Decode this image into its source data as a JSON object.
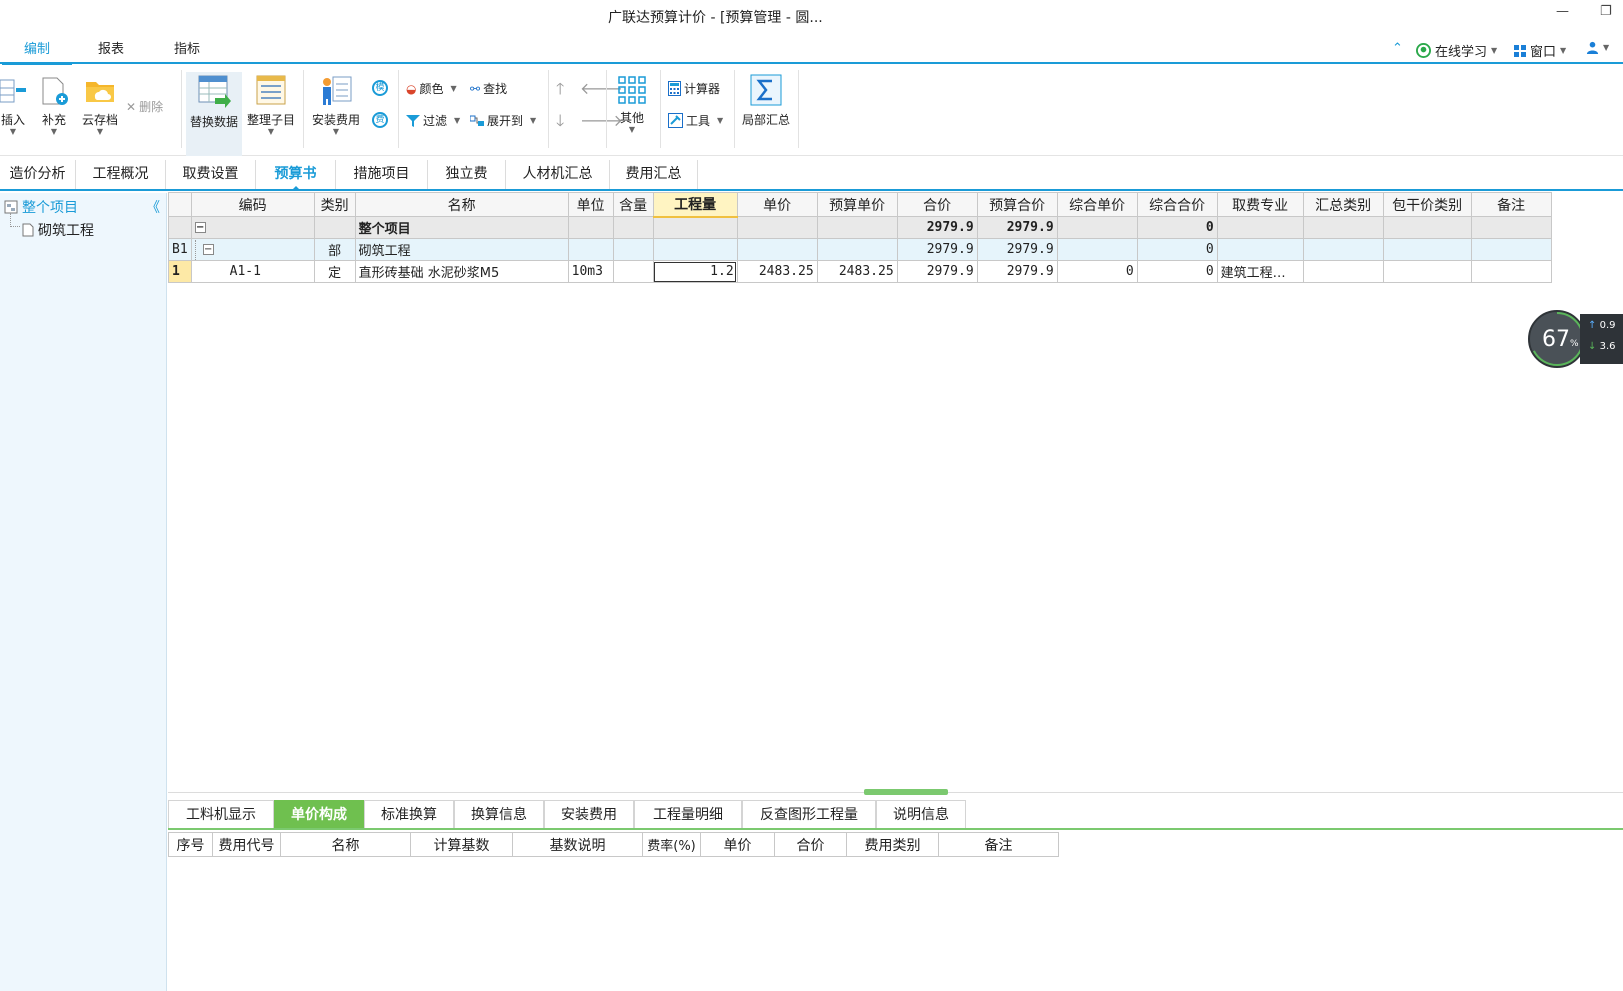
{
  "window": {
    "title": "广联达预算计价 - [预算管理 - 圆...",
    "min": "—",
    "restore": "❐"
  },
  "menu": {
    "tabs": [
      "编制",
      "报表",
      "指标"
    ],
    "right": {
      "collapse": "⌃",
      "online": "在线学习",
      "window": "窗口"
    }
  },
  "ribbon": {
    "insert": "插入",
    "supplement": "补充",
    "cloud": "云存档",
    "delete": "删除",
    "replace": "替换数据",
    "organize": "整理子目",
    "install_fee": "安装费用",
    "mo": "模",
    "fei": "费",
    "color": "颜色",
    "find": "查找",
    "filter": "过滤",
    "expand": "展开到",
    "other": "其他",
    "calc": "计算器",
    "tools": "工具",
    "partial_sum": "局部汇总"
  },
  "page_tabs": [
    "造价分析",
    "工程概况",
    "取费设置",
    "预算书",
    "措施项目",
    "独立费",
    "人材机汇总",
    "费用汇总"
  ],
  "tree": {
    "root": "整个项目",
    "child": "砌筑工程",
    "collapse": "《"
  },
  "grid": {
    "headers": [
      "编码",
      "类别",
      "名称",
      "单位",
      "含量",
      "工程量",
      "单价",
      "预算单价",
      "合价",
      "预算合价",
      "综合单价",
      "综合合价",
      "取费专业",
      "汇总类别",
      "包干价类别",
      "备注"
    ],
    "rows": [
      {
        "rowhead": "",
        "code": "",
        "type": "",
        "name": "整个项目",
        "unit": "",
        "content": "",
        "qty": "",
        "price": "",
        "budget_price": "",
        "total": "2979.9",
        "budget_total": "2979.9",
        "comp_price": "",
        "comp_total": "0",
        "fee_spec": "",
        "sum_type": "",
        "pkg_type": "",
        "remark": ""
      },
      {
        "rowhead": "B1",
        "code": "",
        "type": "部",
        "name": "砌筑工程",
        "unit": "",
        "content": "",
        "qty": "",
        "price": "",
        "budget_price": "",
        "total": "2979.9",
        "budget_total": "2979.9",
        "comp_price": "",
        "comp_total": "0",
        "fee_spec": "",
        "sum_type": "",
        "pkg_type": "",
        "remark": ""
      },
      {
        "rowhead": "1",
        "code": "A1-1",
        "type": "定",
        "name": "直形砖基础 水泥砂浆M5",
        "unit": "10m3",
        "content": "",
        "qty": "1.2",
        "price": "2483.25",
        "budget_price": "2483.25",
        "total": "2979.9",
        "budget_total": "2979.9",
        "comp_price": "0",
        "comp_total": "0",
        "fee_spec": "建筑工程…",
        "sum_type": "",
        "pkg_type": "",
        "remark": ""
      }
    ]
  },
  "bottom_tabs": [
    "工料机显示",
    "单价构成",
    "标准换算",
    "换算信息",
    "安装费用",
    "工程量明细",
    "反查图形工程量",
    "说明信息"
  ],
  "bottom_grid": {
    "headers": [
      "序号",
      "费用代号",
      "名称",
      "计算基数",
      "基数说明",
      "费率(%)",
      "单价",
      "合价",
      "费用类别",
      "备注"
    ]
  },
  "perf": {
    "percent": "67",
    "unit": "%",
    "up": "0.9",
    "down": "3.6",
    "up_arrow": "↑",
    "down_arrow": "↓"
  },
  "colors": {
    "accent": "#1a9bd7",
    "green": "#6fc04f"
  }
}
